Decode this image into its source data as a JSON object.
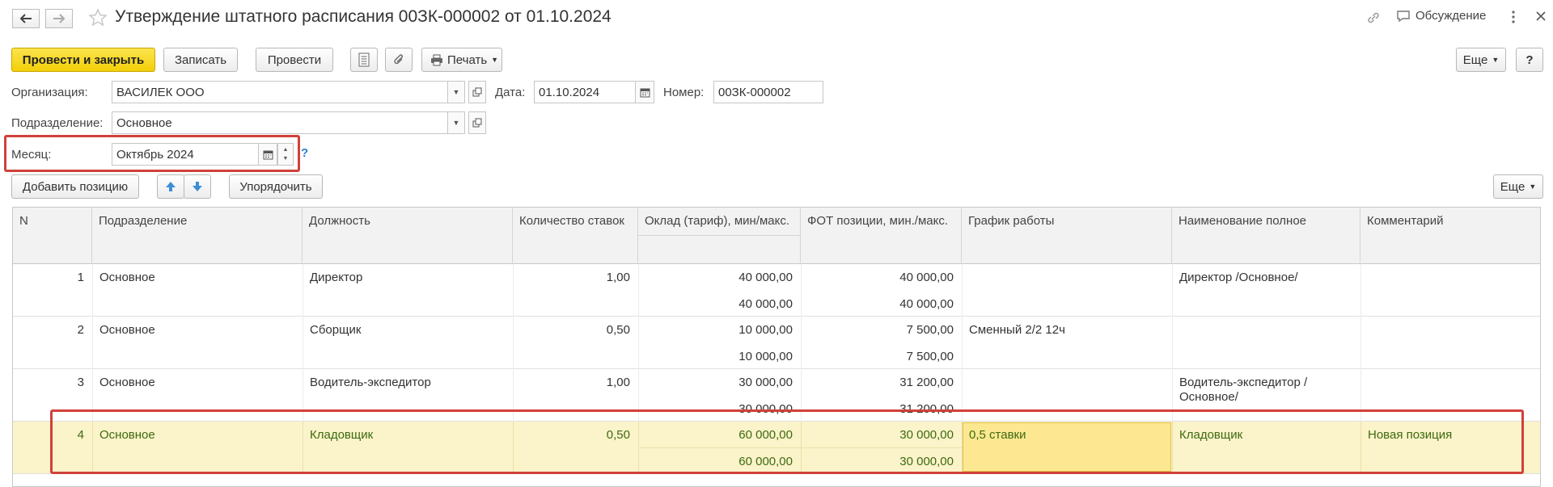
{
  "window": {
    "title": "Утверждение штатного расписания 00ЗК-000002 от 01.10.2024",
    "discussion_label": "Обсуждение"
  },
  "toolbar": {
    "post_close_label": "Провести и закрыть",
    "save_label": "Записать",
    "post_label": "Провести",
    "print_label": "Печать",
    "more_label": "Еще",
    "help_label": "?"
  },
  "header": {
    "org_label": "Организация:",
    "org_value": "ВАСИЛЕК ООО",
    "date_label": "Дата:",
    "date_value": "01.10.2024",
    "number_label": "Номер:",
    "number_value": "00ЗК-000002",
    "dept_label": "Подразделение:",
    "dept_value": "Основное",
    "month_label": "Месяц:",
    "month_value": "Октябрь 2024",
    "month_help": "?"
  },
  "table_toolbar": {
    "add_label": "Добавить позицию",
    "sort_label": "Упорядочить",
    "more_label": "Еще"
  },
  "table": {
    "columns": {
      "n": "N",
      "dept": "Подразделение",
      "position": "Должность",
      "rates": "Количество ставок",
      "salary": "Оклад (тариф), мин/макс.",
      "fot": "ФОТ позиции, мин./макс.",
      "schedule": "График работы",
      "full_name": "Наименование полное",
      "comment": "Комментарий"
    },
    "rows": [
      {
        "n": "1",
        "dept": "Основное",
        "position": "Директор",
        "rates": "1,00",
        "salary_min": "40 000,00",
        "salary_max": "40 000,00",
        "fot_min": "40 000,00",
        "fot_max": "40 000,00",
        "schedule": "",
        "full_name_1": "Директор /Основное/",
        "full_name_2": "",
        "comment": ""
      },
      {
        "n": "2",
        "dept": "Основное",
        "position": "Сборщик",
        "rates": "0,50",
        "salary_min": "10 000,00",
        "salary_max": "10 000,00",
        "fot_min": "7 500,00",
        "fot_max": "7 500,00",
        "schedule": "Сменный 2/2 12ч",
        "full_name_1": "",
        "full_name_2": "",
        "comment": ""
      },
      {
        "n": "3",
        "dept": "Основное",
        "position": "Водитель-экспедитор",
        "rates": "1,00",
        "salary_min": "30 000,00",
        "salary_max": "30 000,00",
        "fot_min": "31 200,00",
        "fot_max": "31 200,00",
        "schedule": "",
        "full_name_1": "Водитель-экспедитор /",
        "full_name_2": "Основное/",
        "comment": ""
      },
      {
        "n": "4",
        "dept": "Основное",
        "position": "Кладовщик",
        "rates": "0,50",
        "salary_min": "60 000,00",
        "salary_max": "60 000,00",
        "fot_min": "30 000,00",
        "fot_max": "30 000,00",
        "schedule": "0,5 ставки",
        "full_name_1": "Кладовщик",
        "full_name_2": "",
        "comment": "Новая позиция"
      }
    ]
  },
  "colors": {
    "primary_button": "#f3cf08",
    "highlight_box": "#d0413a",
    "selected_row": "#fbf3c9",
    "selected_cell": "#fde891",
    "selected_text": "#3d6a11",
    "arrow_blue": "#3c8fd6"
  }
}
